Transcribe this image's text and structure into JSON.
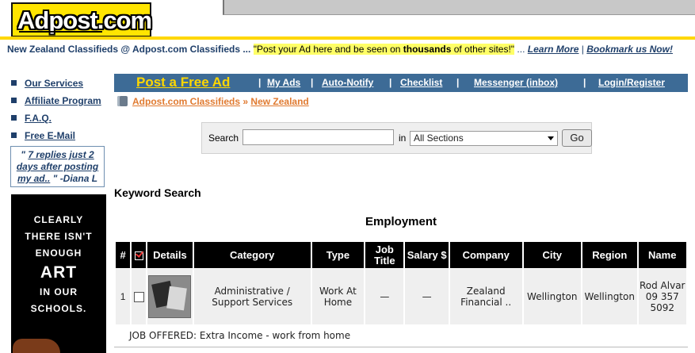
{
  "header": {
    "logo": "Adpost.com",
    "tagline_prefix": "New Zealand Classifieds @ Adpost.com Classifieds ...",
    "tagline_quote_a": "\"Post your Ad here and be seen on ",
    "tagline_quote_bold": "thousands",
    "tagline_quote_b": " of other sites!\"",
    "tagline_ellipsis": "...",
    "learn_more": "Learn More",
    "divider": "|",
    "bookmark": "Bookmark us Now!",
    "colors": {
      "brand_yellow": "#ffe500",
      "nav_blue": "#3d6b96",
      "link_orange": "#e07a30",
      "text_navy": "#1f3f6a"
    }
  },
  "sidebar": {
    "items": [
      {
        "label": "Our Services"
      },
      {
        "label": "Affiliate Program"
      },
      {
        "label": "F.A.Q."
      },
      {
        "label": "Free E-Mail"
      }
    ],
    "testimonial": {
      "open": "\" ",
      "link": "7 replies just 2 days after posting my ad..",
      "close": " \"",
      "author": "-Diana L"
    },
    "ad": {
      "line1": "CLEARLY",
      "line2": "THERE ISN'T",
      "line3": "ENOUGH",
      "line4": "ART",
      "line5": "IN OUR",
      "line6": "SCHOOLS."
    }
  },
  "nav": {
    "post": "Post a Free Ad",
    "sep": "|",
    "links": [
      "My Ads",
      "Auto-Notify",
      "Checklist",
      "Messenger (inbox)",
      "Login/Register"
    ]
  },
  "breadcrumb": {
    "root": "Adpost.com Classifieds",
    "sep": "»",
    "current": "New Zealand"
  },
  "search": {
    "label": "Search",
    "value": "",
    "in_label": "in",
    "section": "All Sections",
    "go": "Go"
  },
  "results": {
    "heading": "Keyword Search",
    "category_title": "Employment",
    "columns": [
      "#",
      "",
      "Details",
      "Category",
      "Type",
      "Job Title",
      "Salary $",
      "Company",
      "City",
      "Region",
      "Name"
    ],
    "rows": [
      {
        "num": "1",
        "category": "Administrative / Support Services",
        "type": "Work At Home",
        "job_title": "—",
        "salary": "—",
        "company": "Zealand Financial ..",
        "city": "Wellington",
        "region": "Wellington",
        "name": "Rod Alvar 09 357 5092",
        "description": "JOB OFFERED: Extra Income - work from home"
      }
    ]
  }
}
